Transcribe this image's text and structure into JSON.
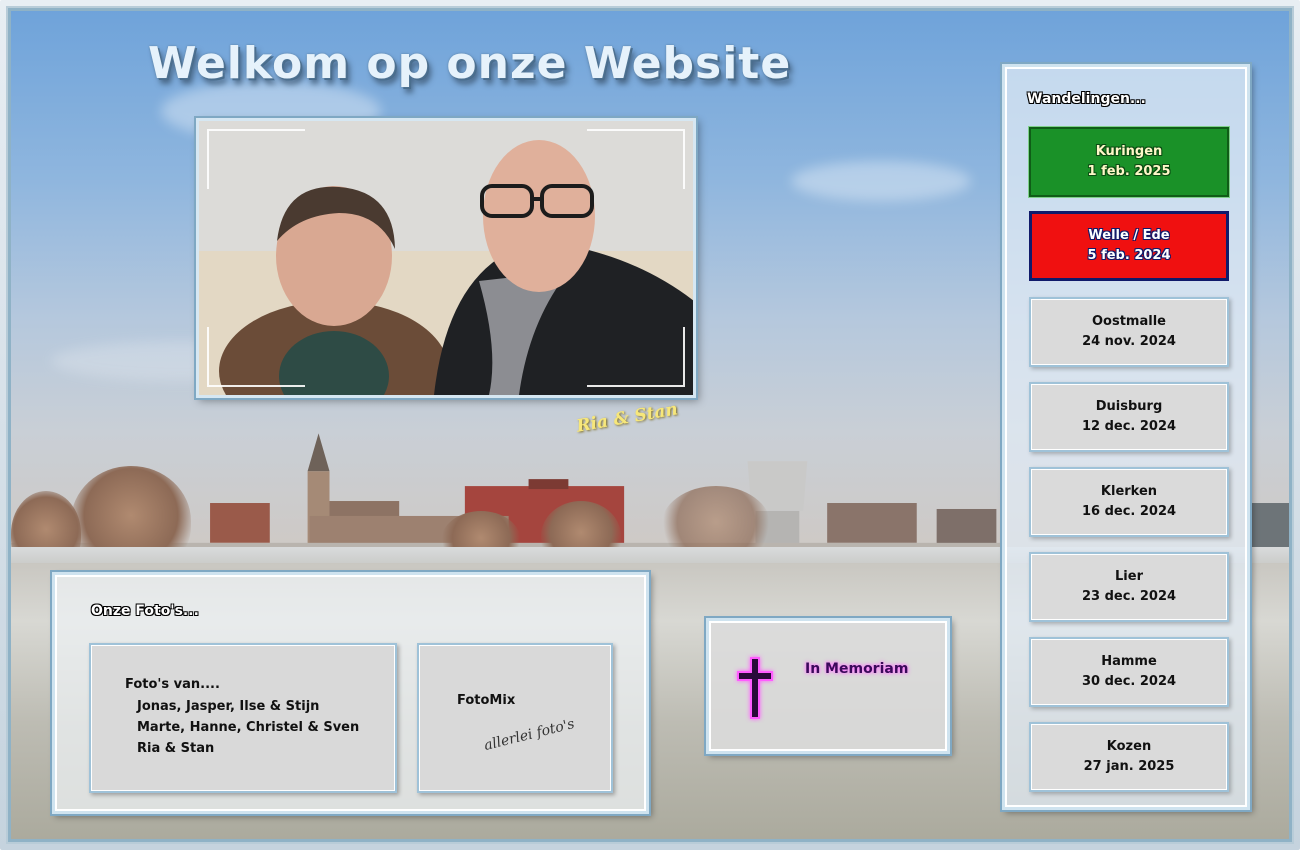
{
  "page": {
    "title": "Welkom op onze Website",
    "photo_caption": "Ria & Stan"
  },
  "photos_section": {
    "title": "Onze Foto's...",
    "family_card": {
      "heading": "Foto's van....",
      "lines": [
        "Jonas, Jasper, Ilse & Stijn",
        "Marte, Hanne, Christel & Sven",
        "Ria & Stan"
      ]
    },
    "fotomix_card": {
      "title": "FotoMix",
      "subtitle": "allerlei foto's"
    }
  },
  "memoriam": {
    "label": "In Memoriam",
    "icon": "cross-icon"
  },
  "walks": {
    "title": "Wandelingen...",
    "items": [
      {
        "place": "Kuringen",
        "date": "1 feb. 2025",
        "style": "green"
      },
      {
        "place": "Welle / Ede",
        "date": "5 feb. 2024",
        "style": "red"
      },
      {
        "place": "Oostmalle",
        "date": "24 nov. 2024",
        "style": "grey"
      },
      {
        "place": "Duisburg",
        "date": "12 dec. 2024",
        "style": "grey"
      },
      {
        "place": "Klerken",
        "date": "16 dec. 2024",
        "style": "grey"
      },
      {
        "place": "Lier",
        "date": "23 dec. 2024",
        "style": "grey"
      },
      {
        "place": "Hamme",
        "date": "30 dec. 2024",
        "style": "grey"
      },
      {
        "place": "Kozen",
        "date": "27 jan. 2025",
        "style": "grey"
      }
    ]
  },
  "colors": {
    "accent_green": "#1a9128",
    "accent_red": "#f01010",
    "frame_blue": "#7fa8c3"
  }
}
